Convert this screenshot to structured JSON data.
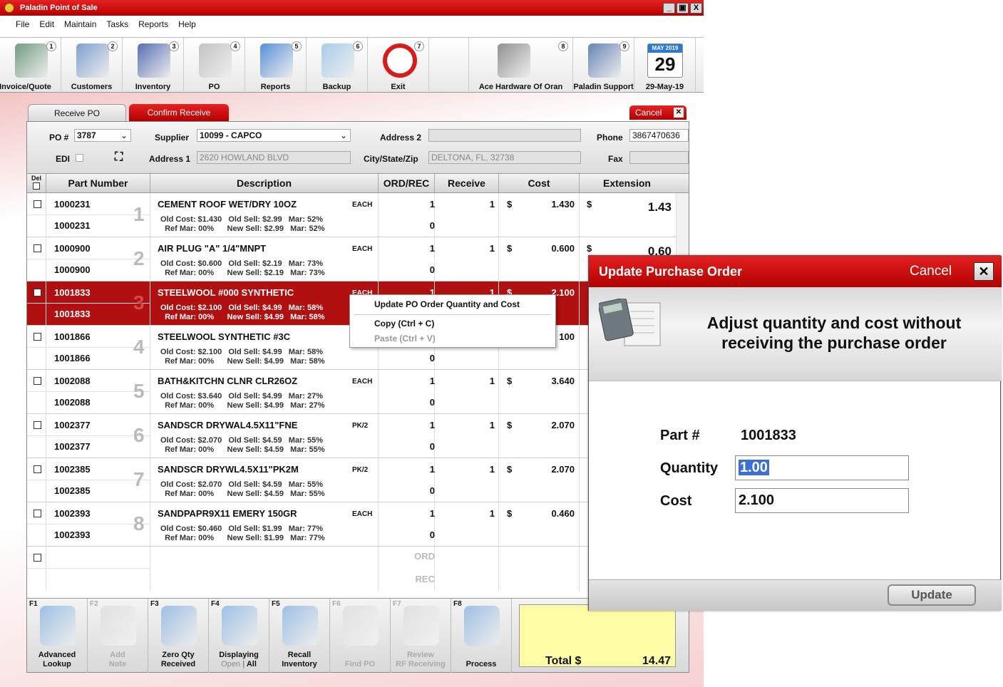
{
  "app": {
    "title": "Paladin Point of Sale"
  },
  "menu": [
    "File",
    "Edit",
    "Maintain",
    "Tasks",
    "Reports",
    "Help"
  ],
  "toolbar": [
    {
      "num": "1",
      "label": "Invoice/Quote",
      "icon": "invoice-icon"
    },
    {
      "num": "2",
      "label": "Customers",
      "icon": "customers-icon"
    },
    {
      "num": "3",
      "label": "Inventory",
      "icon": "inventory-icon"
    },
    {
      "num": "4",
      "label": "PO",
      "icon": "po-icon"
    },
    {
      "num": "5",
      "label": "Reports",
      "icon": "reports-icon"
    },
    {
      "num": "6",
      "label": "Backup",
      "icon": "backup-icon"
    },
    {
      "num": "7",
      "label": "Exit",
      "icon": "exit-icon"
    },
    {
      "num": "",
      "label": "",
      "icon": ""
    },
    {
      "num": "8",
      "label": "Ace Hardware Of Oran",
      "icon": "store-icon"
    },
    {
      "num": "9",
      "label": "Paladin Support",
      "icon": "support-icon"
    },
    {
      "num": "",
      "label": "29-May-19",
      "icon": "calendar-icon"
    }
  ],
  "calendar": {
    "month": "MAY",
    "year": "2019",
    "day": "29"
  },
  "tabs": {
    "receive": "Receive PO",
    "confirm": "Confirm Receive",
    "cancel": "Cancel"
  },
  "header": {
    "po_label": "PO #",
    "po_value": "3787",
    "edi_label": "EDI",
    "supplier_label": "Supplier",
    "supplier_value": "10099 - CAPCO",
    "address1_label": "Address 1",
    "address1_value": "2620 HOWLAND BLVD",
    "address2_label": "Address 2",
    "address2_value": "",
    "city_label": "City/State/Zip",
    "city_value": "DELTONA, FL, 32738",
    "phone_label": "Phone",
    "phone_value": "3867470636",
    "fax_label": "Fax",
    "fax_value": ""
  },
  "columns": {
    "del": "Del",
    "part": "Part Number",
    "desc": "Description",
    "ordrec": "ORD/REC",
    "receive": "Receive",
    "cost": "Cost",
    "extension": "Extension"
  },
  "rows": [
    {
      "part": "1000231",
      "line": "1",
      "desc": "CEMENT ROOF WET/DRY 10OZ",
      "unit": "EACH",
      "sub1": "Old Cost: $1.430   Old Sell: $2.99   Mar: 52%",
      "sub2": "Ref Mar: 00%      New Sell: $2.99   Mar: 52%",
      "ord": "1",
      "rec": "0",
      "receive": "1",
      "dollar": "$",
      "cost": "1.430",
      "ext_dollar": "$",
      "ext": "1.43"
    },
    {
      "part": "1000900",
      "line": "2",
      "desc": "AIR PLUG \"A\" 1/4\"MNPT",
      "unit": "EACH",
      "sub1": "Old Cost: $0.600   Old Sell: $2.19   Mar: 73%",
      "sub2": "Ref Mar: 00%      New Sell: $2.19   Mar: 73%",
      "ord": "1",
      "rec": "0",
      "receive": "1",
      "dollar": "$",
      "cost": "0.600",
      "ext_dollar": "$",
      "ext": "0.60"
    },
    {
      "part": "1001833",
      "line": "3",
      "desc": "STEELWOOL #000 SYNTHETIC",
      "unit": "EACH",
      "sub1": "Old Cost: $2.100   Old Sell: $4.99   Mar: 58%",
      "sub2": "Ref Mar: 00%      New Sell: $4.99   Mar: 58%",
      "ord": "1",
      "rec": "0",
      "receive": "1",
      "dollar": "$",
      "cost": "2.100",
      "ext_dollar": "",
      "ext": ""
    },
    {
      "part": "1001866",
      "line": "4",
      "desc": "STEELWOOL SYNTHETIC #3C",
      "unit": "",
      "sub1": "Old Cost: $2.100   Old Sell: $4.99   Mar: 58%",
      "sub2": "Ref Mar: 00%      New Sell: $4.99   Mar: 58%",
      "ord": "",
      "rec": "0",
      "receive": "",
      "dollar": "",
      "cost": "100",
      "ext_dollar": "",
      "ext": ""
    },
    {
      "part": "1002088",
      "line": "5",
      "desc": "BATH&KITCHN CLNR CLR26OZ",
      "unit": "EACH",
      "sub1": "Old Cost: $3.640   Old Sell: $4.99   Mar: 27%",
      "sub2": "Ref Mar: 00%      New Sell: $4.99   Mar: 27%",
      "ord": "1",
      "rec": "0",
      "receive": "1",
      "dollar": "$",
      "cost": "3.640",
      "ext_dollar": "",
      "ext": ""
    },
    {
      "part": "1002377",
      "line": "6",
      "desc": "SANDSCR DRYWAL4.5X11\"FNE",
      "unit": "PK/2",
      "sub1": "Old Cost: $2.070   Old Sell: $4.59   Mar: 55%",
      "sub2": "Ref Mar: 00%      New Sell: $4.59   Mar: 55%",
      "ord": "1",
      "rec": "0",
      "receive": "1",
      "dollar": "$",
      "cost": "2.070",
      "ext_dollar": "",
      "ext": ""
    },
    {
      "part": "1002385",
      "line": "7",
      "desc": "SANDSCR DRYWL4.5X11\"PK2M",
      "unit": "PK/2",
      "sub1": "Old Cost: $2.070   Old Sell: $4.59   Mar: 55%",
      "sub2": "Ref Mar: 00%      New Sell: $4.59   Mar: 55%",
      "ord": "1",
      "rec": "0",
      "receive": "1",
      "dollar": "$",
      "cost": "2.070",
      "ext_dollar": "",
      "ext": ""
    },
    {
      "part": "1002393",
      "line": "8",
      "desc": "SANDPAPR9X11 EMERY 150GR",
      "unit": "EACH",
      "sub1": "Old Cost: $0.460   Old Sell: $1.99   Mar: 77%",
      "sub2": "Ref Mar: 00%      New Sell: $1.99   Mar: 77%",
      "ord": "1",
      "rec": "0",
      "receive": "1",
      "dollar": "$",
      "cost": "0.460",
      "ext_dollar": "",
      "ext": ""
    }
  ],
  "empty_row": {
    "ord": "ORD",
    "rec": "REC"
  },
  "context_menu": {
    "item1": "Update PO Order Quantity and Cost",
    "item2": "Copy (Ctrl + C)",
    "item3": "Paste (Ctrl + V)"
  },
  "fkeys": [
    {
      "key": "F1",
      "label1": "Advanced",
      "label2": "Lookup",
      "icon": "magnifier-icon",
      "enabled": true
    },
    {
      "key": "F2",
      "label1": "Add",
      "label2": "Note",
      "icon": "note-icon",
      "enabled": false
    },
    {
      "key": "F3",
      "label1": "Zero Qty",
      "label2": "Received",
      "icon": "box-cancel-icon",
      "enabled": true
    },
    {
      "key": "F4",
      "label1": "Displaying",
      "label2": "",
      "icon": "binoculars-icon",
      "enabled": true
    },
    {
      "key": "F5",
      "label1": "Recall",
      "label2": "Inventory",
      "icon": "recall-icon",
      "enabled": true
    },
    {
      "key": "F6",
      "label1": "",
      "label2": "Find PO",
      "icon": "find-po-icon",
      "enabled": false
    },
    {
      "key": "F7",
      "label1": "Review",
      "label2": "RF Receiving",
      "icon": "rf-icon",
      "enabled": false
    },
    {
      "key": "F8",
      "label1": "",
      "label2": "Process",
      "icon": "truck-icon",
      "enabled": true
    }
  ],
  "display_toggle": {
    "open": "Open",
    "sep": " | ",
    "all": "All"
  },
  "total": {
    "label": "Total $",
    "value": "14.47"
  },
  "dialog": {
    "title": "Update Purchase Order",
    "cancel": "Cancel",
    "message": "Adjust quantity and cost without receiving the purchase order",
    "part_label": "Part #",
    "part_value": "1001833",
    "qty_label": "Quantity",
    "qty_value": "1.00",
    "cost_label": "Cost",
    "cost_value": "2.100",
    "update": "Update"
  },
  "colors": {
    "brand_red": "#c40000",
    "selected_row": "#b01010",
    "total_bg": "#fefca4",
    "highlight": "#3a6fd8"
  }
}
